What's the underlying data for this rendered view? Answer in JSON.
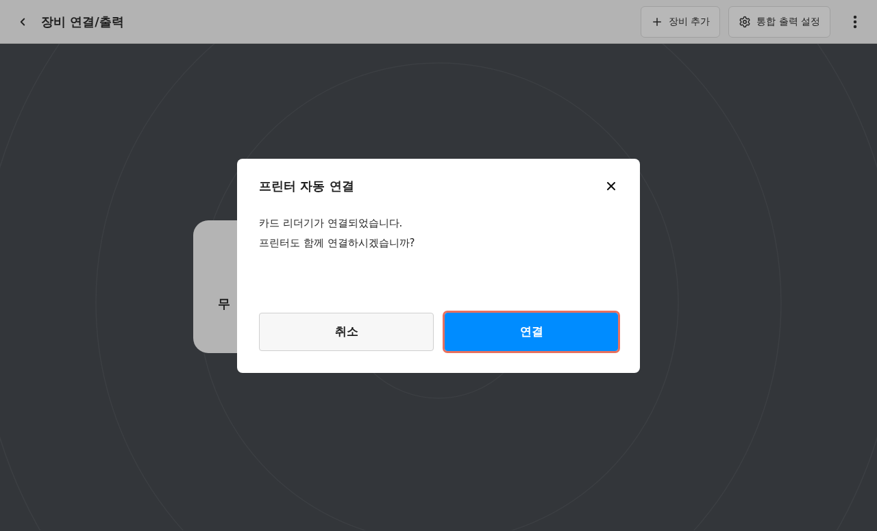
{
  "header": {
    "title": "장비 연결/출력",
    "actions": [
      {
        "kind": "add",
        "label": "장비 추가"
      },
      {
        "kind": "settings",
        "label": "통합 출력 설정"
      }
    ]
  },
  "device_card": {
    "label": "무"
  },
  "dialog": {
    "title": "프린터 자동 연결",
    "message_lines": [
      "카드 리더기가 연결되었습니다.",
      "프린터도 함께 연결하시겠습니까?"
    ],
    "buttons": [
      {
        "kind": "secondary",
        "label": "취소",
        "focused": false
      },
      {
        "kind": "primary",
        "label": "연결",
        "focused": true
      }
    ]
  }
}
